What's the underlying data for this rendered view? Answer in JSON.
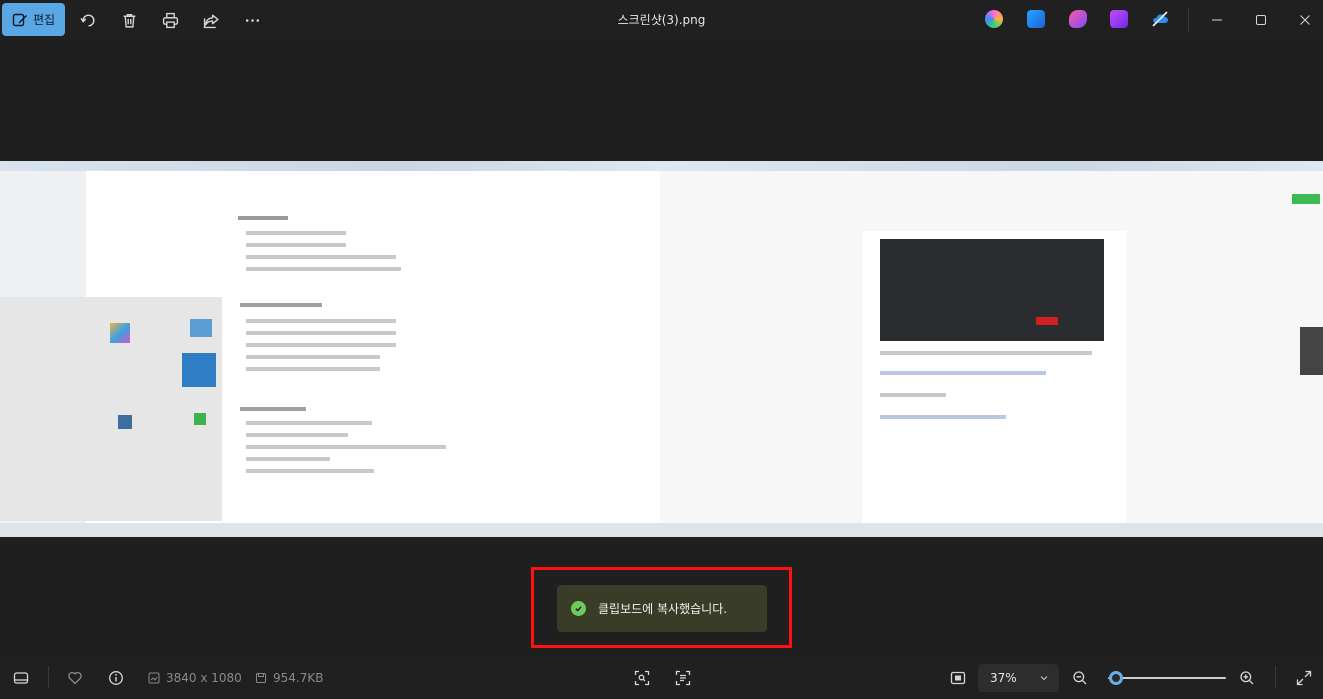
{
  "titlebar": {
    "edit_label": "편집",
    "file_name": "스크린샷(3).png"
  },
  "toast": {
    "message": "클립보드에 복사했습니다."
  },
  "bottombar": {
    "dimensions": "3840 x 1080",
    "file_size": "954.7KB",
    "zoom_value": "37%",
    "zoom_fraction": 0.07
  },
  "colors": {
    "accent": "#5aa7e6",
    "toast_bg": "#393c26",
    "toast_ok": "#6ccb5f",
    "highlight_box": "#ff1010"
  },
  "icons": [
    "edit-icon",
    "rotate-icon",
    "delete-icon",
    "print-icon",
    "share-icon",
    "more-icon",
    "copilot-app-icon",
    "designer-app-icon",
    "clipchamp-app-icon",
    "video-editor-app-icon",
    "onedrive-app-icon",
    "minimize-icon",
    "maximize-icon",
    "close-icon",
    "filmstrip-icon",
    "favorite-icon",
    "info-icon",
    "dimensions-icon",
    "file-size-icon",
    "visual-search-icon",
    "text-scan-icon",
    "fit-screen-icon",
    "zoom-out-icon",
    "zoom-in-icon",
    "fullscreen-icon"
  ]
}
